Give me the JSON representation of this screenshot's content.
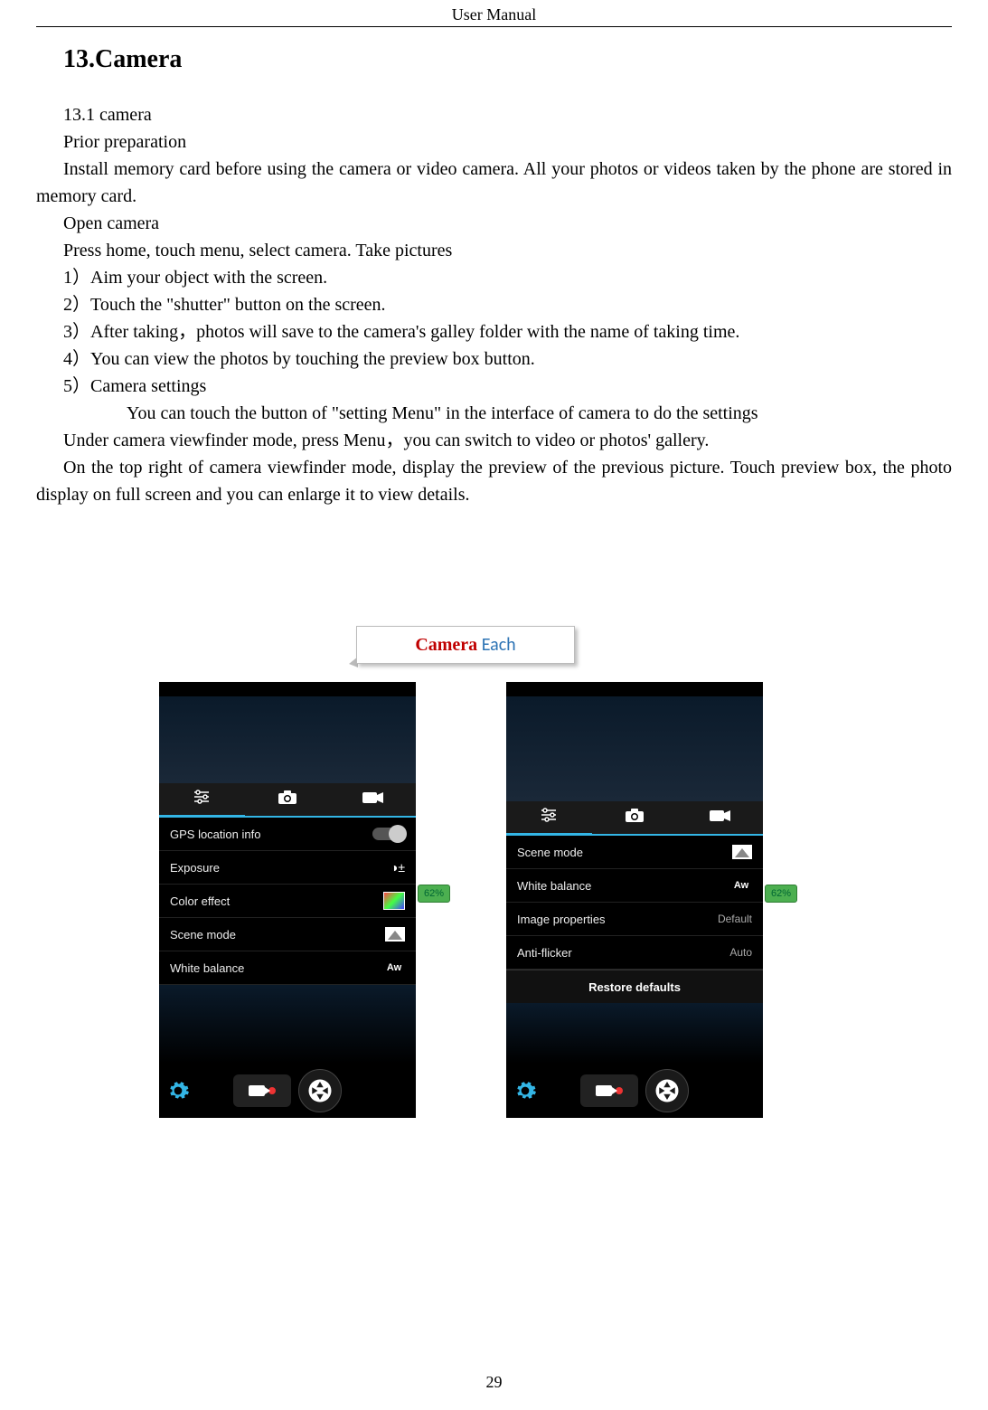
{
  "header": "User    Manual",
  "section_title": "13.Camera",
  "paragraphs": {
    "p1": "13.1 camera",
    "p2": "Prior preparation",
    "p3": "Install memory card before using the camera or video camera. All your photos or videos taken by the phone are stored in memory card.",
    "p4": "Open camera",
    "p5": "Press home, touch menu, select camera. Take pictures",
    "l1": "1）Aim your object with the screen.",
    "l2": "2）Touch the \"shutter\" button on the screen.",
    "l3": "3）After taking，photos will save to the camera's galley folder with the name of taking time.",
    "l4": "4）You can view the photos by touching the preview box button.",
    "l5": "5）Camera settings",
    "l5b": "You can touch the button of \"setting Menu\" in the interface of camera to do the settings",
    "p6": "Under camera viewfinder mode, press Menu，you can switch to video or photos' gallery.",
    "p7": "On the top right of camera viewfinder mode, display the preview of the previous picture. Touch preview box, the photo display on full screen and you can enlarge it to view details."
  },
  "callout": {
    "red": "Camera",
    "blue": " Each"
  },
  "battery_badge": "62%",
  "screen_left": {
    "rows": [
      {
        "label": "GPS location info",
        "type": "toggle"
      },
      {
        "label": "Exposure",
        "type": "chevron"
      },
      {
        "label": "Color effect",
        "type": "swatch"
      },
      {
        "label": "Scene mode",
        "type": "scene"
      },
      {
        "label": "White balance",
        "type": "aw"
      }
    ]
  },
  "screen_right": {
    "rows": [
      {
        "label": "Scene mode",
        "type": "scene"
      },
      {
        "label": "White balance",
        "type": "aw"
      },
      {
        "label": "Image properties",
        "value": "Default"
      },
      {
        "label": "Anti-flicker",
        "value": "Auto"
      }
    ],
    "restore": "Restore defaults"
  },
  "page_number": "29"
}
